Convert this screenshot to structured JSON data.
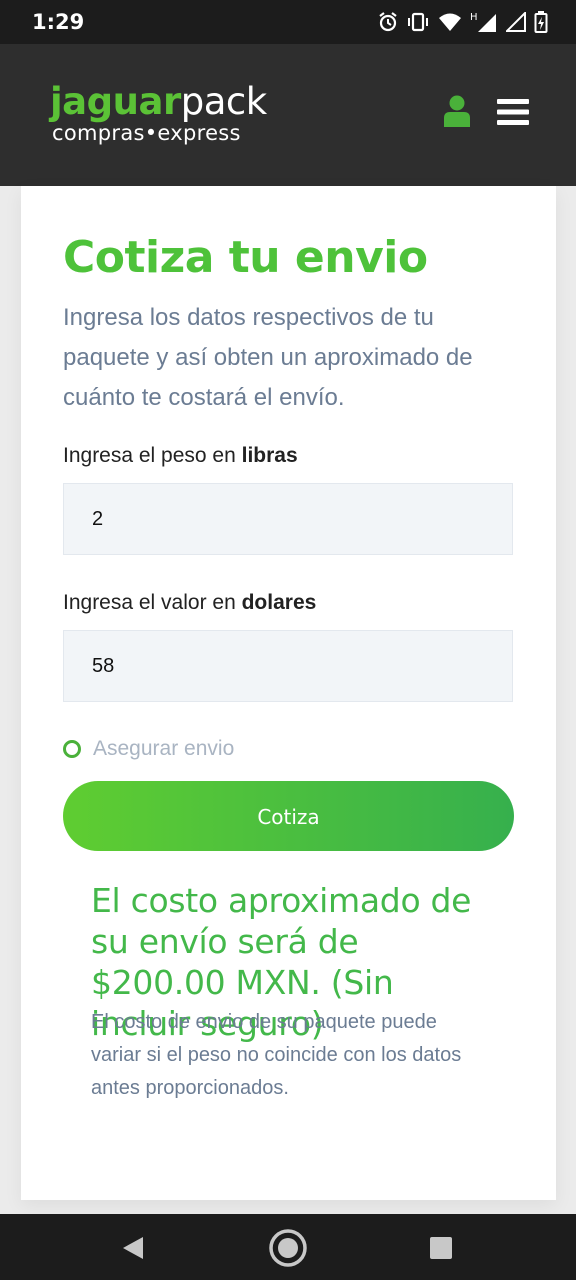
{
  "status_bar": {
    "time": "1:29",
    "icons": [
      "alarm-icon",
      "vibrate-icon",
      "wifi-icon",
      "signal-h-icon",
      "signal-icon",
      "battery-icon"
    ],
    "network_type": "H"
  },
  "header": {
    "logo": {
      "bold": "jaguar",
      "light": "pack",
      "tagline": "compras•express"
    },
    "brand_color": "#5bc236",
    "icons": [
      "user-icon",
      "menu-icon"
    ]
  },
  "form": {
    "title": "Cotiza tu envio",
    "subtitle": "Ingresa los datos respectivos de tu paquete y así obten un aproximado de cuánto te costará el envío.",
    "weight": {
      "label_prefix": "Ingresa el peso en ",
      "label_bold": "libras",
      "value": "2"
    },
    "value": {
      "label_prefix": "Ingresa el valor en ",
      "label_bold": "dolares",
      "value": "58"
    },
    "insure_label": "Asegurar envio",
    "submit_label": "Cotiza"
  },
  "result": {
    "headline": "El costo aproximado de su envío será de $200.00 MXN. (Sin incluir seguro)",
    "note": "El costo de envio de su paquete puede variar si el peso no coincide con los datos antes proporcionados."
  },
  "navbar": {
    "icons": [
      "back-icon",
      "home-icon",
      "recent-apps-icon"
    ]
  }
}
